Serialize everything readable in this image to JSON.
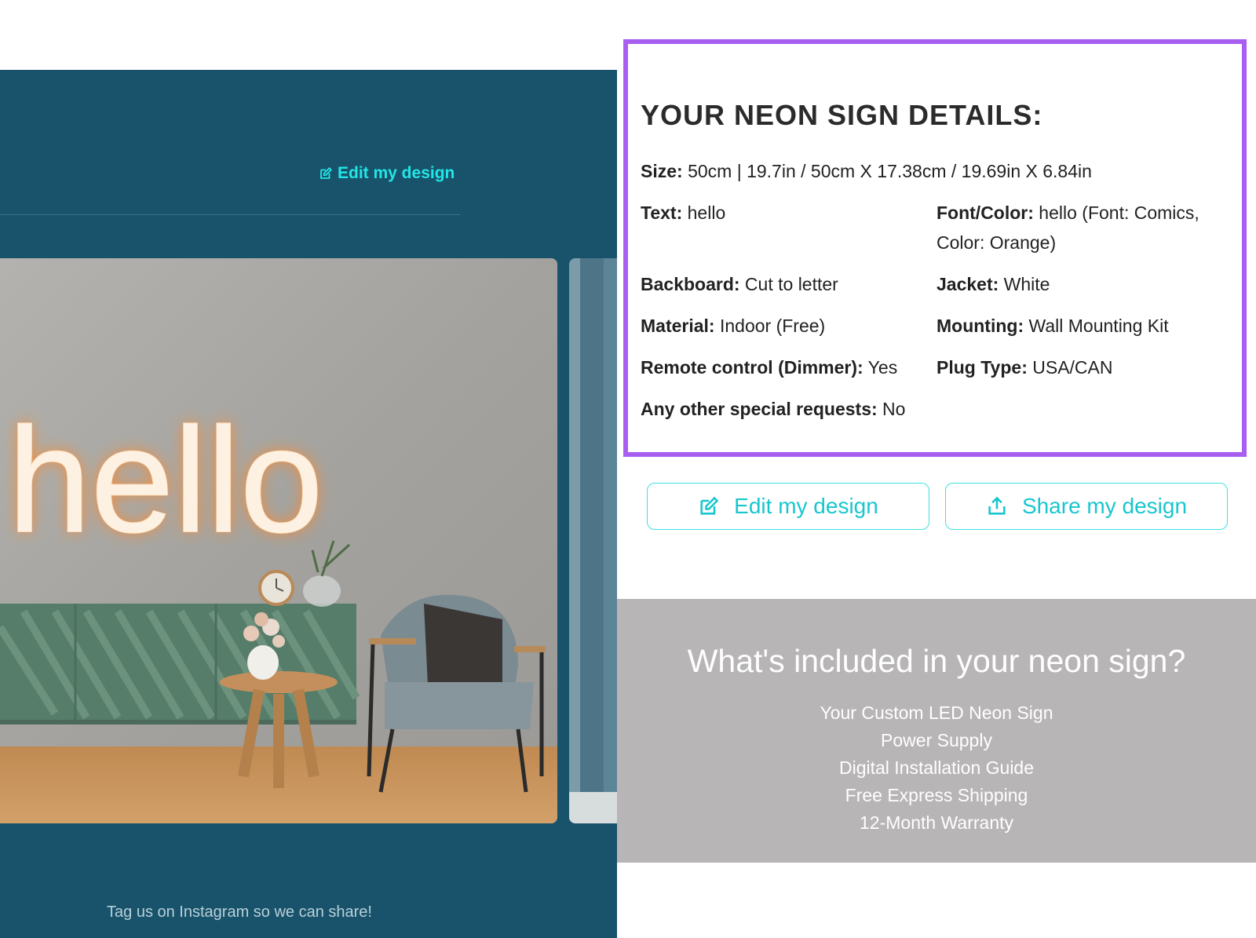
{
  "left": {
    "edit_link": "Edit my design",
    "neon_text": "hello",
    "instagram_note": "Tag us on Instagram so we can share!"
  },
  "details": {
    "title": "YOUR NEON SIGN DETAILS:",
    "size": {
      "label": "Size:",
      "value": " 50cm | 19.7in / 50cm X 17.38cm / 19.69in X 6.84in"
    },
    "text": {
      "label": "Text:",
      "value": " hello"
    },
    "font_color": {
      "label": "Font/Color:",
      "value_line1": " hello (Font: Comics,",
      "value_line2": "Color: Orange)"
    },
    "backboard": {
      "label": "Backboard:",
      "value": " Cut to letter"
    },
    "jacket": {
      "label": "Jacket:",
      "value": " White"
    },
    "material": {
      "label": "Material:",
      "value": " Indoor (Free)"
    },
    "mounting": {
      "label": "Mounting:",
      "value": " Wall Mounting Kit"
    },
    "remote": {
      "label": "Remote control (Dimmer):",
      "value": " Yes"
    },
    "plug": {
      "label": "Plug Type:",
      "value": " USA/CAN"
    },
    "special": {
      "label": "Any other special requests:",
      "value": " No"
    }
  },
  "buttons": {
    "edit": "Edit my design",
    "share": "Share my design"
  },
  "included": {
    "title": "What's included in your neon sign?",
    "items": [
      "Your Custom LED Neon Sign",
      "Power Supply",
      "Digital Installation Guide",
      "Free Express Shipping",
      "12-Month Warranty"
    ]
  },
  "colors": {
    "panel": "#18536b",
    "accent": "#22e6e6",
    "highlight_border": "#a85ef0",
    "included_bg": "#b8b5b6",
    "neon": "#ff8a2a"
  }
}
